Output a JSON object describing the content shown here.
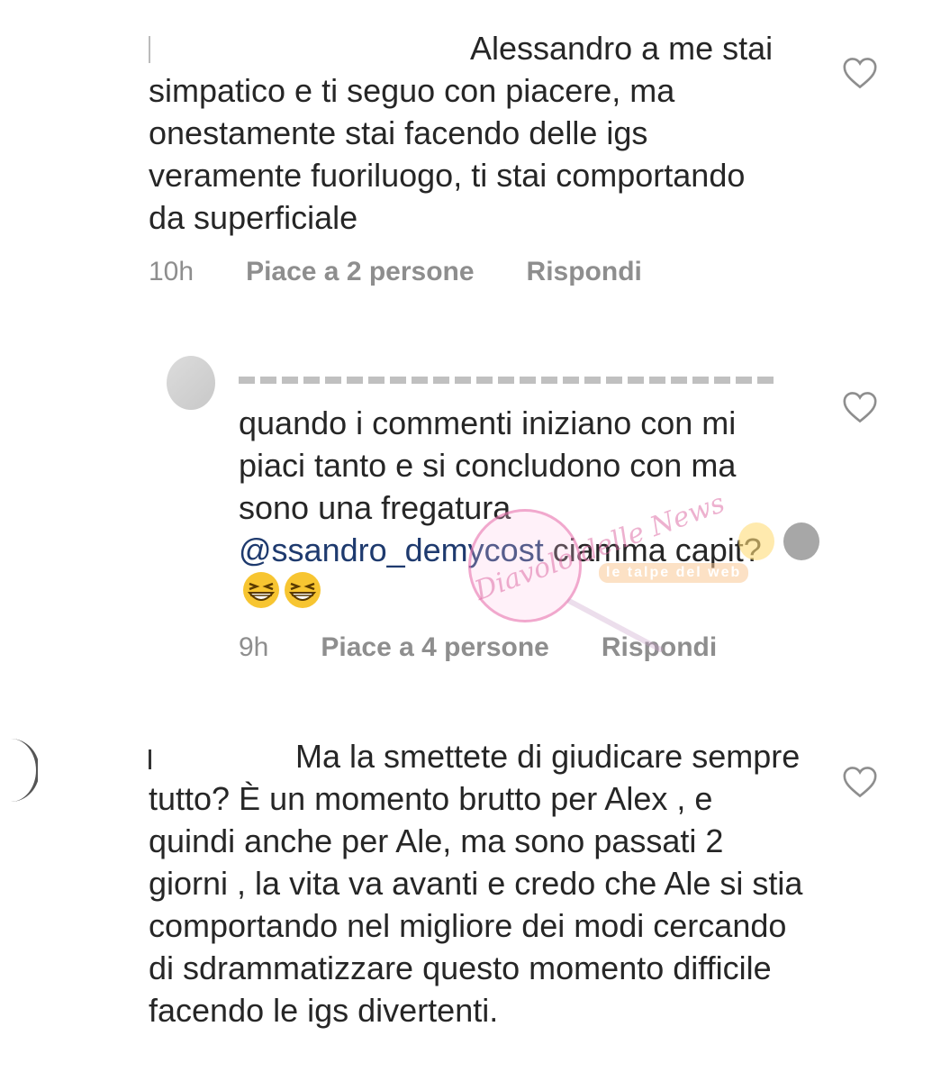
{
  "comments": [
    {
      "text_first": "Alessandro a me",
      "text_rest": "stai simpatico e ti seguo con piacere, ma onestamente stai facendo delle igs veramente fuoriluogo, ti stai comportando da superficiale",
      "time": "10h",
      "likes": "Piace a 2 persone",
      "reply": "Rispondi",
      "icon": "heart-outline"
    },
    {
      "text": "quando i commenti iniziano con mi piaci tanto e si concludono con ma sono una fregatura",
      "mention": "@ssandro_demycost",
      "text_after_mention": " ciamma capit?",
      "emoji": "grinning-squinting-face x2",
      "time": "9h",
      "likes": "Piace a 4 persone",
      "reply": "Rispondi",
      "icon": "heart-outline"
    },
    {
      "text_first": "Ma la smettete di giudicare",
      "text_rest": "sempre tutto? È un momento brutto per Alex , e quindi anche per Ale, ma sono passati 2 giorni , la vita va avanti e credo che Ale si stia comportando nel migliore dei modi cercando di sdrammatizzare questo momento difficile facendo le igs divertenti.",
      "icon": "heart-outline"
    }
  ],
  "watermark": {
    "script": "Diavolo delle News",
    "banner": "le talpe del web"
  },
  "colors": {
    "text": "#262626",
    "meta": "#8e8e8e",
    "mention": "#1e3a6e"
  }
}
